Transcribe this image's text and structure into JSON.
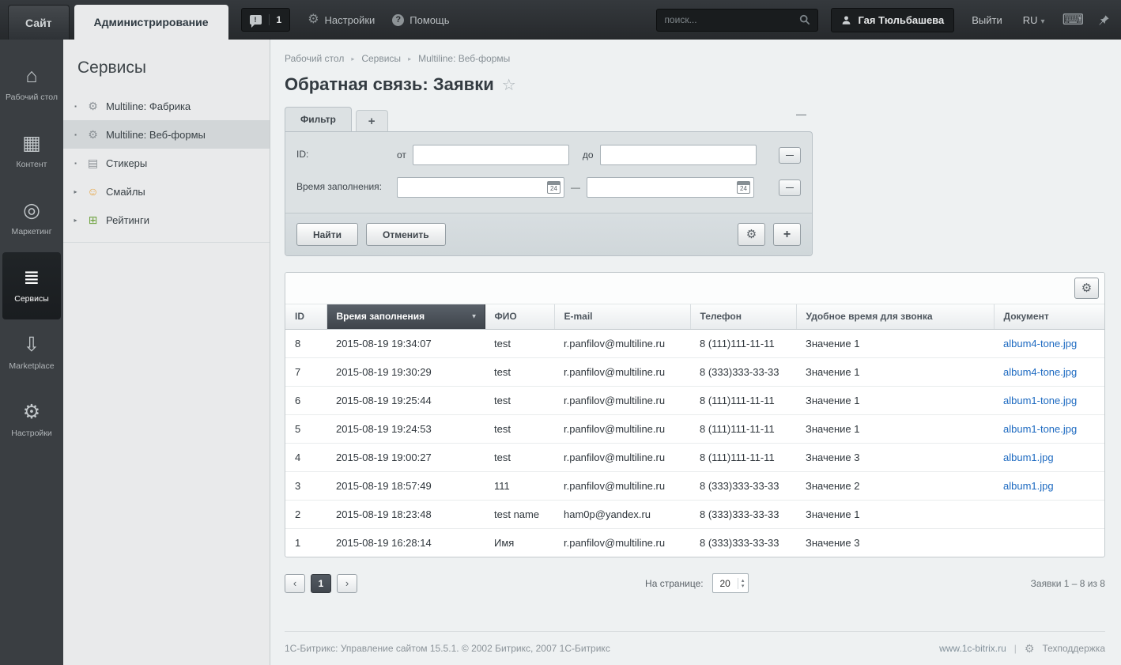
{
  "colors": {
    "topbar_bg": "#2c3034",
    "leftnav_bg": "#3a3e42",
    "link": "#1d6ac1",
    "sorted_header": "#4a515a",
    "selected_item": "#d2d6d8"
  },
  "topbar": {
    "site_tab": "Сайт",
    "admin_tab": "Администрирование",
    "notification_count": "1",
    "settings_label": "Настройки",
    "help_label": "Помощь",
    "search_placeholder": "поиск...",
    "user_name": "Гая Тюльбашева",
    "logout_label": "Выйти",
    "lang_label": "RU"
  },
  "leftnav": {
    "items": [
      {
        "label": "Рабочий стол",
        "icon": "home-icon",
        "active": false
      },
      {
        "label": "Контент",
        "icon": "content-icon",
        "active": false
      },
      {
        "label": "Маркетинг",
        "icon": "marketing-icon",
        "active": false
      },
      {
        "label": "Сервисы",
        "icon": "services-icon",
        "active": true
      },
      {
        "label": "Marketplace",
        "icon": "marketplace-icon",
        "active": false
      },
      {
        "label": "Настройки",
        "icon": "settings-icon",
        "active": false
      }
    ]
  },
  "sidebar": {
    "title": "Сервисы",
    "items": [
      {
        "label": "Multiline: Фабрика",
        "icon": "gear-icon",
        "expandable": false,
        "selected": false
      },
      {
        "label": "Multiline: Веб-формы",
        "icon": "gear-icon",
        "expandable": false,
        "selected": true
      },
      {
        "label": "Стикеры",
        "icon": "sticker-icon",
        "expandable": false,
        "selected": false
      },
      {
        "label": "Смайлы",
        "icon": "smiley-icon",
        "expandable": true,
        "selected": false
      },
      {
        "label": "Рейтинги",
        "icon": "rating-icon",
        "expandable": true,
        "selected": false
      }
    ]
  },
  "breadcrumb": {
    "items": [
      "Рабочий стол",
      "Сервисы",
      "Multiline: Веб-формы"
    ]
  },
  "page": {
    "title": "Обратная связь: Заявки"
  },
  "filter": {
    "tab_label": "Фильтр",
    "add_tab_label": "+",
    "id_label": "ID:",
    "from_label": "от",
    "to_label": "до",
    "time_label": "Время заполнения:",
    "find_button": "Найти",
    "cancel_button": "Отменить"
  },
  "table": {
    "columns": [
      "ID",
      "Время заполнения",
      "ФИО",
      "E-mail",
      "Телефон",
      "Удобное время для звонка",
      "Документ"
    ],
    "sorted_column_index": 1,
    "rows": [
      [
        "8",
        "2015-08-19 19:34:07",
        "test",
        "r.panfilov@multiline.ru",
        "8 (111)111-11-11",
        "Значение 1",
        "album4-tone.jpg"
      ],
      [
        "7",
        "2015-08-19 19:30:29",
        "test",
        "r.panfilov@multiline.ru",
        "8 (333)333-33-33",
        "Значение 1",
        "album4-tone.jpg"
      ],
      [
        "6",
        "2015-08-19 19:25:44",
        "test",
        "r.panfilov@multiline.ru",
        "8 (111)111-11-11",
        "Значение 1",
        "album1-tone.jpg"
      ],
      [
        "5",
        "2015-08-19 19:24:53",
        "test",
        "r.panfilov@multiline.ru",
        "8 (111)111-11-11",
        "Значение 1",
        "album1-tone.jpg"
      ],
      [
        "4",
        "2015-08-19 19:00:27",
        "test",
        "r.panfilov@multiline.ru",
        "8 (111)111-11-11",
        "Значение 3",
        "album1.jpg"
      ],
      [
        "3",
        "2015-08-19 18:57:49",
        "111",
        "r.panfilov@multiline.ru",
        "8 (333)333-33-33",
        "Значение 2",
        "album1.jpg"
      ],
      [
        "2",
        "2015-08-19 18:23:48",
        "test name",
        "ham0p@yandex.ru",
        "8 (333)333-33-33",
        "Значение 1",
        ""
      ],
      [
        "1",
        "2015-08-19 16:28:14",
        "Имя",
        "r.panfilov@multiline.ru",
        "8 (333)333-33-33",
        "Значение 3",
        ""
      ]
    ]
  },
  "pagination": {
    "current_page": "1",
    "per_page_label": "На странице:",
    "per_page_value": "20",
    "summary": "Заявки 1 – 8 из 8"
  },
  "footer": {
    "copyright": "1С-Битрикс: Управление сайтом 15.5.1. © 2002 Битрикс, 2007 1С-Битрикс",
    "site_link": "www.1c-bitrix.ru",
    "support_label": "Техподдержка"
  }
}
